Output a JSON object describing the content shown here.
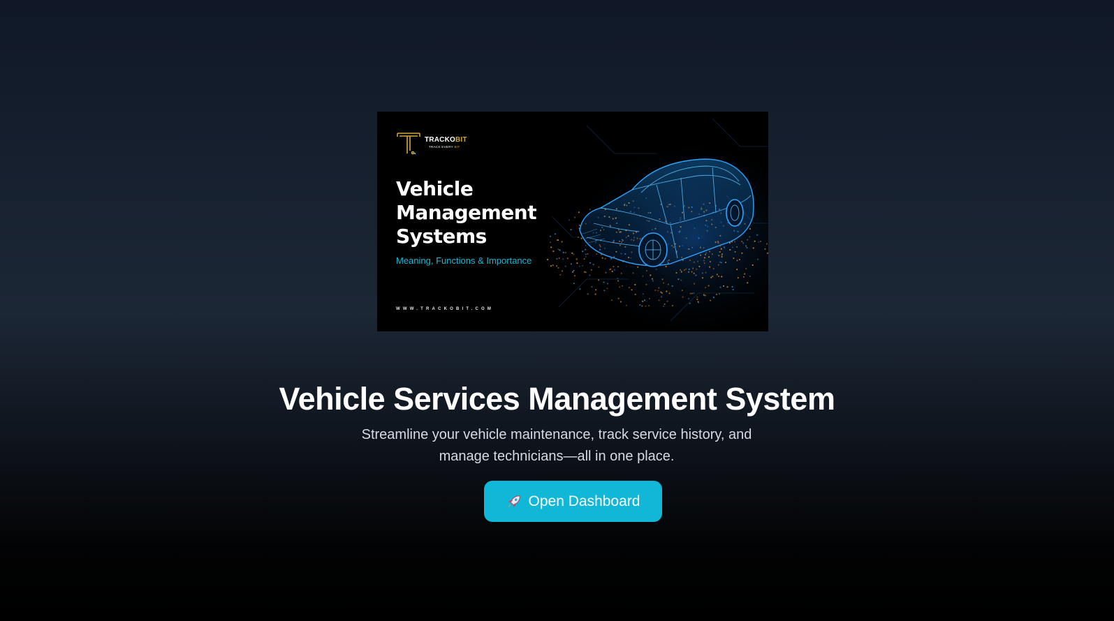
{
  "banner": {
    "brand_name_main": "TRACKO",
    "brand_name_accent": "BIT",
    "brand_tagline_main": "TRACK EVERY ",
    "brand_tagline_accent": "BIT",
    "title_line1": "Vehicle",
    "title_line2": "Management",
    "title_line3": "Systems",
    "subtitle": "Meaning, Functions & Importance",
    "url": "WWW.TRACKOBIT.COM"
  },
  "hero": {
    "title": "Vehicle Services Management System",
    "description": "Streamline your vehicle maintenance, track service history, and manage technicians—all in one place.",
    "cta_label": "Open Dashboard",
    "cta_icon": "rocket-icon"
  },
  "colors": {
    "accent": "#10b7d6",
    "banner_subtitle": "#19b8d8",
    "logo_gold": "#d6a73a",
    "car_wireframe": "#1e9bff"
  }
}
